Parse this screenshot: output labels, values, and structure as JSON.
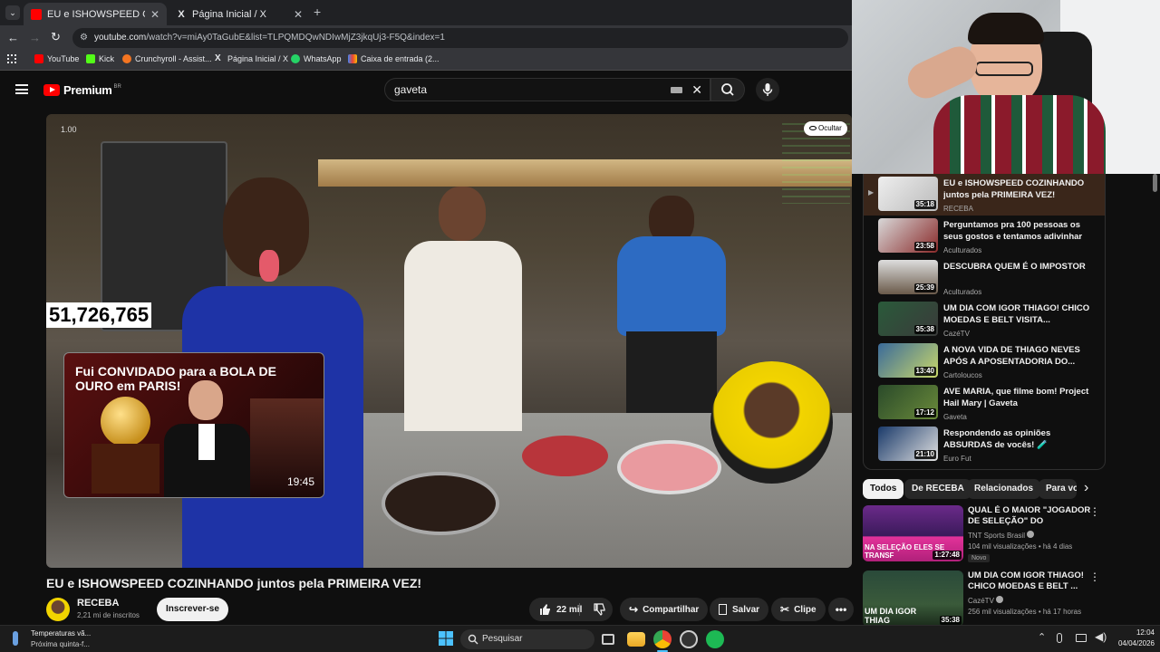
{
  "browser": {
    "tabs": [
      {
        "title": "EU e ISHOWSPEED COZINHANDO juntos pela PRIMEIRA VEZ! - YouTube",
        "favicon": "youtube-icon",
        "active": true
      },
      {
        "title": "Página Inicial / X",
        "favicon": "x-icon",
        "active": false
      }
    ],
    "url_host": "youtube.com",
    "url_path": "/watch?v=miAy0TaGubE&list=TLPQMDQwNDIwMjZ3jkqUj3-F5Q&index=1",
    "bookmarks": [
      "YouTube",
      "Kick",
      "Crunchyroll - Assist...",
      "Página Inicial / X",
      "WhatsApp",
      "Caixa de entrada (2..."
    ]
  },
  "youtube": {
    "logo_text": "Premium",
    "region": "BR",
    "search_value": "gaveta"
  },
  "video": {
    "speed": "1.00",
    "overlay_counter": "51,726,765",
    "hide_label": "Ocultar",
    "endcard": {
      "title": "Fui CONVIDADO para a BOLA DE OURO em PARIS!",
      "duration": "19:45"
    },
    "title": "EU e ISHOWSPEED COZINHANDO juntos pela PRIMEIRA VEZ!",
    "channel": "RECEBA",
    "subscribers": "2,21 mi de inscritos",
    "subscribe_label": "Inscrever-se",
    "likes": "22 mil",
    "share_label": "Compartilhar",
    "save_label": "Salvar",
    "clip_label": "Clipe"
  },
  "playlist": [
    {
      "title": "EU e ISHOWSPEED COZINHANDO juntos pela PRIMEIRA VEZ!",
      "channel": "RECEBA",
      "duration": "35:18",
      "active": true
    },
    {
      "title": "Perguntamos pra 100 pessoas os seus gostos e tentamos adivinhar",
      "channel": "Aculturados",
      "duration": "23:58"
    },
    {
      "title": "DESCUBRA QUEM É O IMPOSTOR",
      "channel": "Aculturados",
      "duration": "25:39"
    },
    {
      "title": "UM DIA COM IGOR THIAGO! CHICO MOEDAS E BELT VISITA...",
      "channel": "CazéTV",
      "duration": "35:38"
    },
    {
      "title": "A NOVA VIDA DE THIAGO NEVES APÓS A APOSENTADORIA DO...",
      "channel": "Cartoloucos",
      "duration": "13:40"
    },
    {
      "title": "AVE MARIA, que filme bom! Project Hail Mary | Gaveta",
      "channel": "Gaveta",
      "duration": "17:12"
    },
    {
      "title": "Respondendo as opiniões ABSURDAS de vocês! 🧪",
      "channel": "Euro Fut",
      "duration": "21:10"
    }
  ],
  "chips": [
    "Todos",
    "De RECEBA",
    "Relacionados",
    "Para vo"
  ],
  "recommendations": [
    {
      "title": "QUAL É O MAIOR \"JOGADOR DE SELEÇÃO\" DO FUTEBOL? | DE ...",
      "channel": "TNT Sports Brasil",
      "meta": "104 mil visualizações • há 4 dias",
      "badge": "Novo",
      "duration": "1:27:48",
      "thumb_text": "NA SELEÇÃO ELES SE TRANSF"
    },
    {
      "title": "UM DIA COM IGOR THIAGO! CHICO MOEDAS E BELT ...",
      "channel": "CazéTV",
      "meta": "256 mil visualizações • há 17 horas",
      "badge": "",
      "duration": "35:38",
      "thumb_text": "UM DIA IGOR THIAG"
    }
  ],
  "taskbar": {
    "weather_title": "Temperaturas vã...",
    "weather_sub": "Próxima quinta-f...",
    "search_placeholder": "Pesquisar",
    "time": "12:04",
    "date": "04/04/2026"
  },
  "colors": {
    "youtube_red": "#ff0000",
    "active_playlist_bg": "#3a261a",
    "fluminense_red": "#8b1a2b",
    "fluminense_green": "#1f5a3a"
  }
}
